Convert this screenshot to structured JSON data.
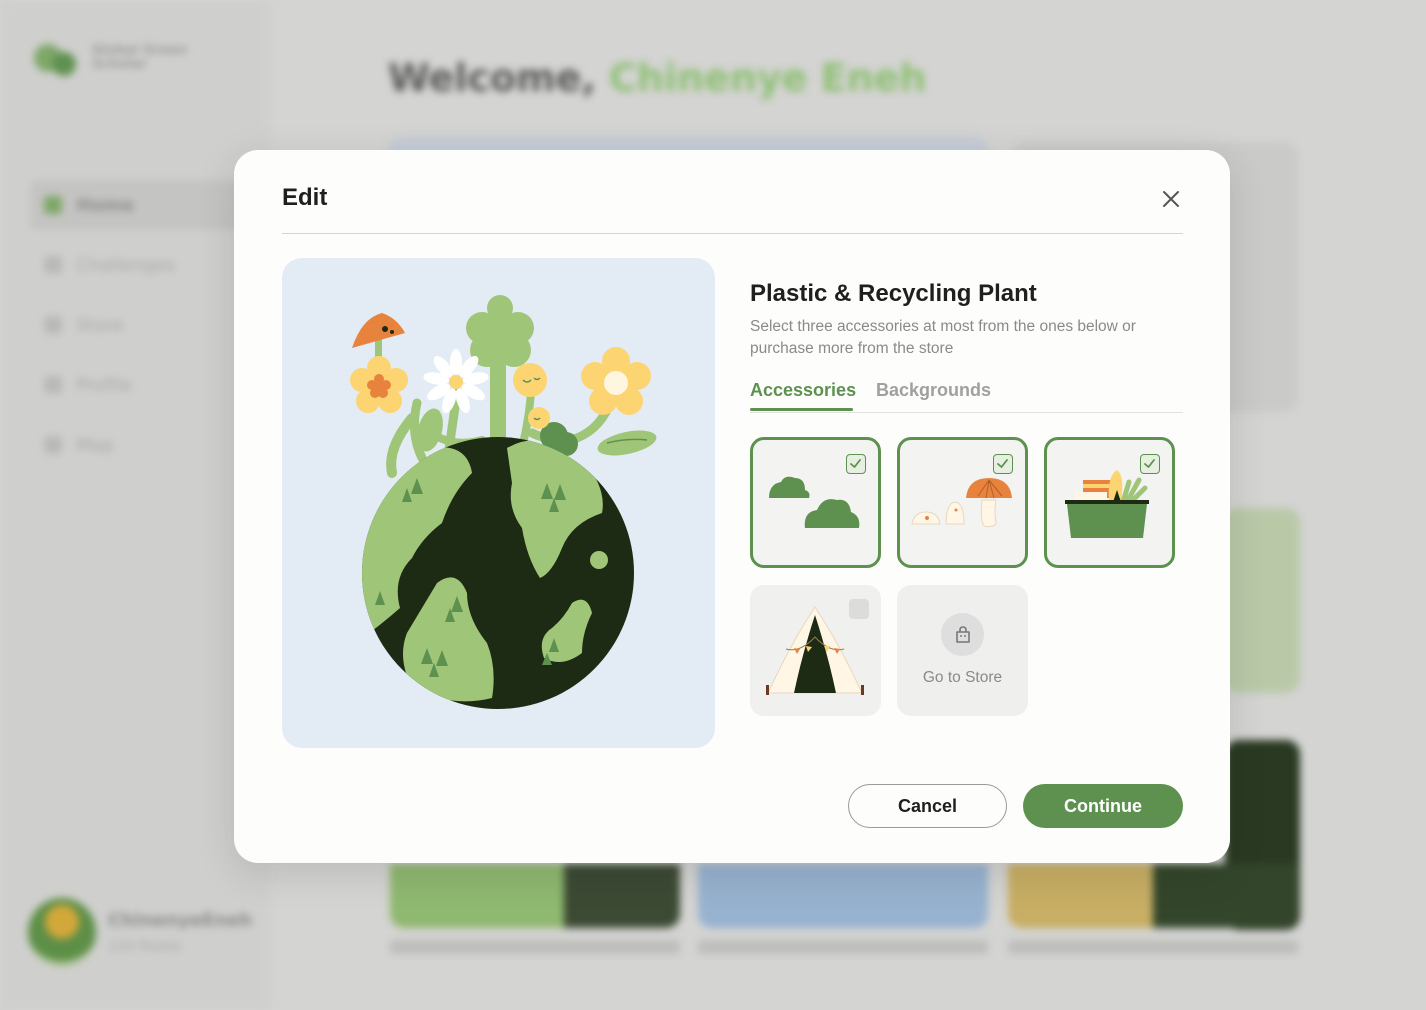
{
  "background": {
    "app_name": "Global Green Scholar",
    "welcome_prefix": "Welcome,",
    "welcome_name": "Chinenye Eneh",
    "nav_items": [
      "Home",
      "Challenges",
      "Store",
      "Profile",
      "Map"
    ],
    "user_name": "ChinenyeEneh",
    "user_sub": "120 Points"
  },
  "modal": {
    "title": "Edit",
    "item_title": "Plastic & Recycling Plant",
    "item_description": "Select three accessories at most from the ones below or purchase more from the store",
    "tabs": [
      {
        "label": "Accessories",
        "active": true
      },
      {
        "label": "Backgrounds",
        "active": false
      }
    ],
    "accessories": [
      {
        "name": "bushes",
        "selected": true
      },
      {
        "name": "mushrooms",
        "selected": true
      },
      {
        "name": "planter-box",
        "selected": true
      },
      {
        "name": "tent",
        "selected": false
      }
    ],
    "store_tile_label": "Go to Store",
    "cancel_label": "Cancel",
    "continue_label": "Continue"
  },
  "colors": {
    "accent": "#5e9150",
    "preview_bg": "#e3ebf5",
    "earth_dark": "#1e2b14",
    "earth_green": "#9fc678",
    "flower_yellow": "#fcd472",
    "mushroom_orange": "#e8833e"
  }
}
